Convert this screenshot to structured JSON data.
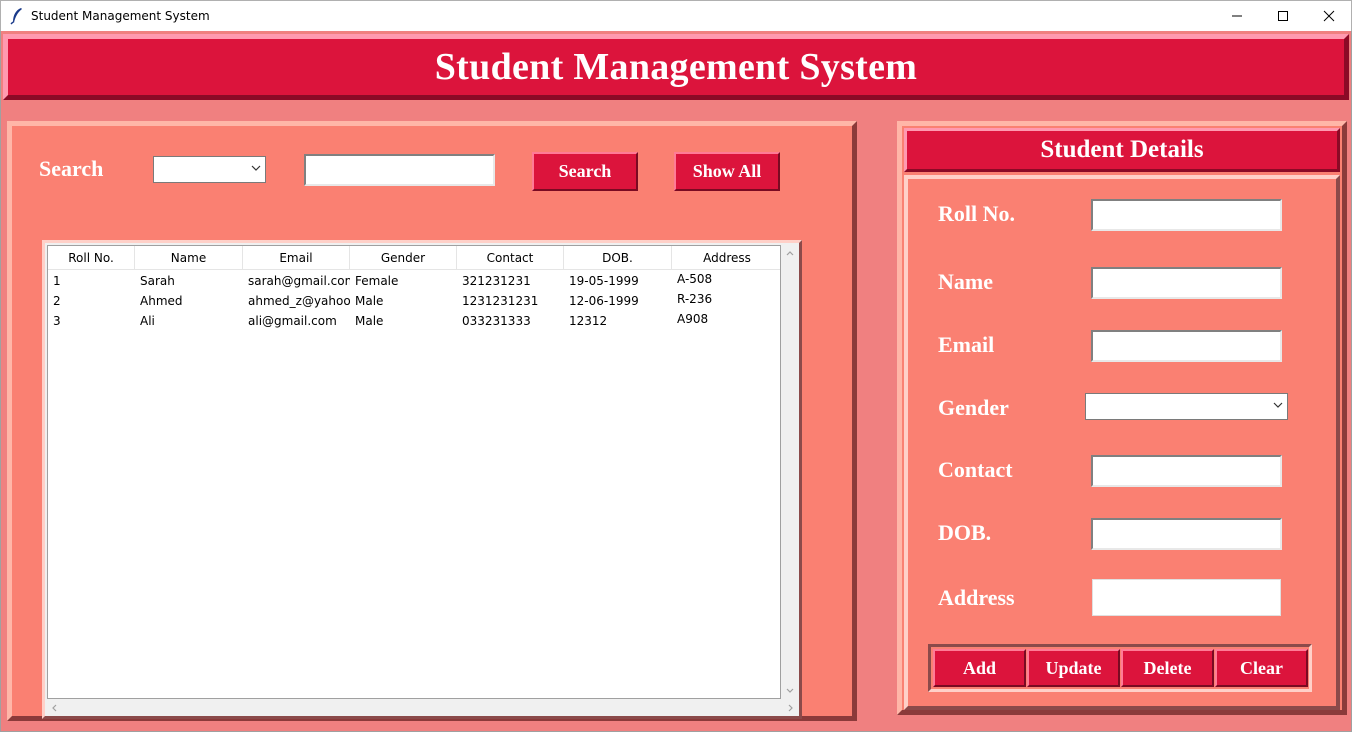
{
  "window": {
    "title": "Student Management System"
  },
  "header": {
    "title": "Student Management System"
  },
  "search": {
    "label": "Search",
    "by_value": "",
    "text_value": "",
    "search_button": "Search",
    "show_all_button": "Show All"
  },
  "table": {
    "columns": [
      "Roll No.",
      "Name",
      "Email",
      "Gender",
      "Contact",
      "DOB.",
      "Address"
    ],
    "rows": [
      [
        "1",
        "Sarah",
        "sarah@gmail.com",
        "Female",
        "321231231",
        "19-05-1999",
        "A-508"
      ],
      [
        "2",
        "Ahmed",
        "ahmed_z@yahoo.c",
        "Male",
        "1231231231",
        "12-06-1999",
        "R-236"
      ],
      [
        "3",
        "Ali",
        "ali@gmail.com",
        "Male",
        "033231333",
        "12312",
        "A908"
      ]
    ]
  },
  "details": {
    "title": "Student Details",
    "fields": {
      "roll": {
        "label": "Roll No.",
        "value": ""
      },
      "name": {
        "label": "Name",
        "value": ""
      },
      "email": {
        "label": "Email",
        "value": ""
      },
      "gender": {
        "label": "Gender",
        "value": ""
      },
      "contact": {
        "label": "Contact",
        "value": ""
      },
      "dob": {
        "label": "DOB.",
        "value": ""
      },
      "address": {
        "label": "Address",
        "value": ""
      }
    },
    "buttons": {
      "add": "Add",
      "update": "Update",
      "delete": "Delete",
      "clear": "Clear"
    }
  },
  "colors": {
    "background": "#f08080",
    "panel": "#fa8072",
    "accent": "#dc143c",
    "text_light": "#ffffff"
  },
  "icons": {
    "app": "feather-icon",
    "minimize": "minimize-icon",
    "maximize": "maximize-icon",
    "close": "close-icon",
    "dropdown": "chevron-down-icon"
  }
}
